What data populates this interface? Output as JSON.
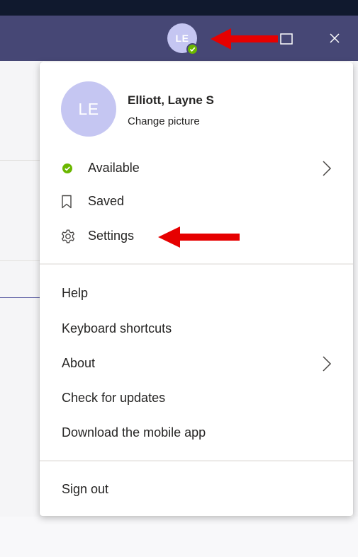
{
  "titlebar": {
    "avatar_initials": "LE",
    "status_color": "#6bb700",
    "bar_color": "#464775",
    "icons": [
      "maximize-icon",
      "close-icon"
    ]
  },
  "menu": {
    "profile": {
      "initials": "LE",
      "name": "Elliott, Layne S",
      "change_picture": "Change picture"
    },
    "status_items": [
      {
        "label": "Available",
        "icon": "available-status-icon"
      },
      {
        "label": "Saved",
        "icon": "bookmark-icon"
      },
      {
        "label": "Settings",
        "icon": "gear-icon"
      }
    ],
    "help_items": [
      {
        "label": "Help"
      },
      {
        "label": "Keyboard shortcuts"
      },
      {
        "label": "About"
      },
      {
        "label": "Check for updates"
      },
      {
        "label": "Download the mobile app"
      }
    ],
    "sign_out": "Sign out"
  },
  "annotations": {
    "arrow_color": "#e60000"
  }
}
